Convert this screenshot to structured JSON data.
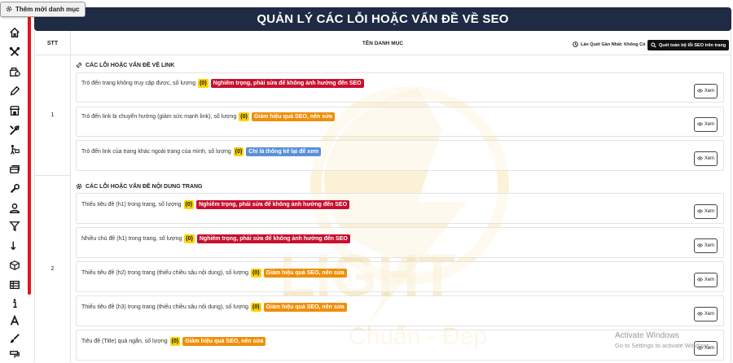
{
  "add_category_label": "Thêm mới danh mục",
  "page_title": "QUẢN LÝ CÁC LỖI HOẶC VẤN ĐỀ VỀ SEO",
  "table": {
    "col_stt": "STT",
    "col_name": "TÊN DANH MỤC",
    "last_scan_label": "Lần Quét Gần Nhất: Không Có",
    "scan_button": "Quét toàn bộ lỗi SEO trên trang"
  },
  "view_label": "Xem",
  "sections": [
    {
      "stt": "1",
      "title": "CÁC LỖI HOẶC VẤN ĐỀ VỀ LINK",
      "items": [
        {
          "text": "Trỏ đến trang không truy cập được, số lượng",
          "count": "(0)",
          "severity": "Nghiêm trọng, phải sửa để không ảnh hưởng đến SEO"
        },
        {
          "text": "Trỏ đến link bị chuyển hướng (giảm sức mạnh link), số lượng",
          "count": "(0)",
          "severity": "Giảm hiệu quả SEO, nên sửa"
        },
        {
          "text": "Trỏ đến link của trang khác ngoài trang của mình, số lượng",
          "count": "(0)",
          "severity": "Chỉ là thống kê lại để xem"
        }
      ]
    },
    {
      "stt": "2",
      "title": "CÁC LỖI HOẶC VẤN ĐỀ NỘI DUNG TRANG",
      "items": [
        {
          "text": "Thiếu tiêu đề (h1) trong trang, số lượng",
          "count": "(0)",
          "severity": "Nghiêm trọng, phải sửa để không ảnh hưởng đến SEO"
        },
        {
          "text": "Nhiều chủ đề (h1) trong trang, số lượng",
          "count": "(0)",
          "severity": "Nghiêm trọng, phải sửa để không ảnh hưởng đến SEO"
        },
        {
          "text": "Thiếu tiêu đề (h2) trong trang (thiếu chiều sâu nội dung), số lượng",
          "count": "(0)",
          "severity": "Giảm hiệu quả SEO, nên sửa"
        },
        {
          "text": "Thiếu tiêu đề (h3) trong trang (thiếu chiều sâu nội dung), số lượng",
          "count": "(0)",
          "severity": "Giảm hiệu quả SEO, nên sửa"
        },
        {
          "text": "Tiêu đề (Title) quá ngắn, số lượng",
          "count": "(0)",
          "severity": "Giảm hiệu quả SEO, nên sửa"
        }
      ]
    }
  ],
  "watermark_text": "LIGHT",
  "watermark_slogan": "Chuẩn - Đẹp",
  "activate": {
    "title": "Activate Windows",
    "subtitle": "Go to Settings to activate Windows."
  },
  "colors": {
    "header_bg": "#1f2a44",
    "sidebar_accent": "#e3131b",
    "severity_serious": "#c8102e",
    "severity_reduce": "#ee8f0a",
    "severity_info": "#5b8fd8",
    "count_bg": "#ffd400"
  }
}
